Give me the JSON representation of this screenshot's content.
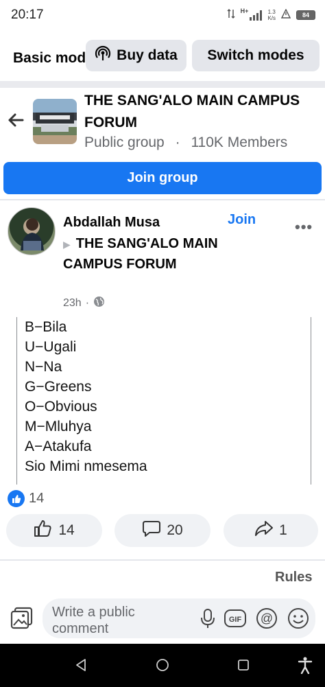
{
  "status_bar": {
    "time": "20:17",
    "network": "H+",
    "speed_top": "1.3",
    "speed_unit": "K/s",
    "battery": "84"
  },
  "mode_bar": {
    "basic_mode_label": "Basic mode",
    "buy_data_label": "Buy data",
    "switch_modes_label": "Switch modes"
  },
  "group": {
    "name": "THE SANG'ALO MAIN CAMPUS FORUM",
    "privacy": "Public group",
    "separator": "·",
    "members": "110K Members",
    "join_label": "Join group"
  },
  "post": {
    "author": "Abdallah Musa",
    "group_name": "THE SANG'ALO MAIN CAMPUS FORUM",
    "join_label": "Join",
    "time": "23h",
    "time_separator": "·",
    "lines": [
      "B−Bila",
      "U−Ugali",
      "N−Na",
      "G−Greens",
      "O−Obvious",
      "M−Mluhya",
      "A−Atakufa",
      "Sio Mimi nmesema"
    ],
    "reaction_count": "14",
    "likes": "14",
    "comments": "20",
    "shares": "1"
  },
  "footer": {
    "rules_label": "Rules",
    "comment_placeholder": "Write a public comment"
  },
  "colors": {
    "accent": "#1877f2",
    "pill_bg": "#e4e6eb",
    "secondary_text": "#65676b"
  },
  "icons": {
    "back": "arrow-left-icon",
    "buy_data": "broadcast-icon",
    "globe": "globe-icon",
    "like": "thumbs-up-icon",
    "comment": "comment-bubble-icon",
    "share": "share-arrow-icon",
    "photo": "photo-icon",
    "mic": "microphone-icon",
    "gif": "gif-icon",
    "mention": "at-icon",
    "emoji": "smiley-icon"
  }
}
